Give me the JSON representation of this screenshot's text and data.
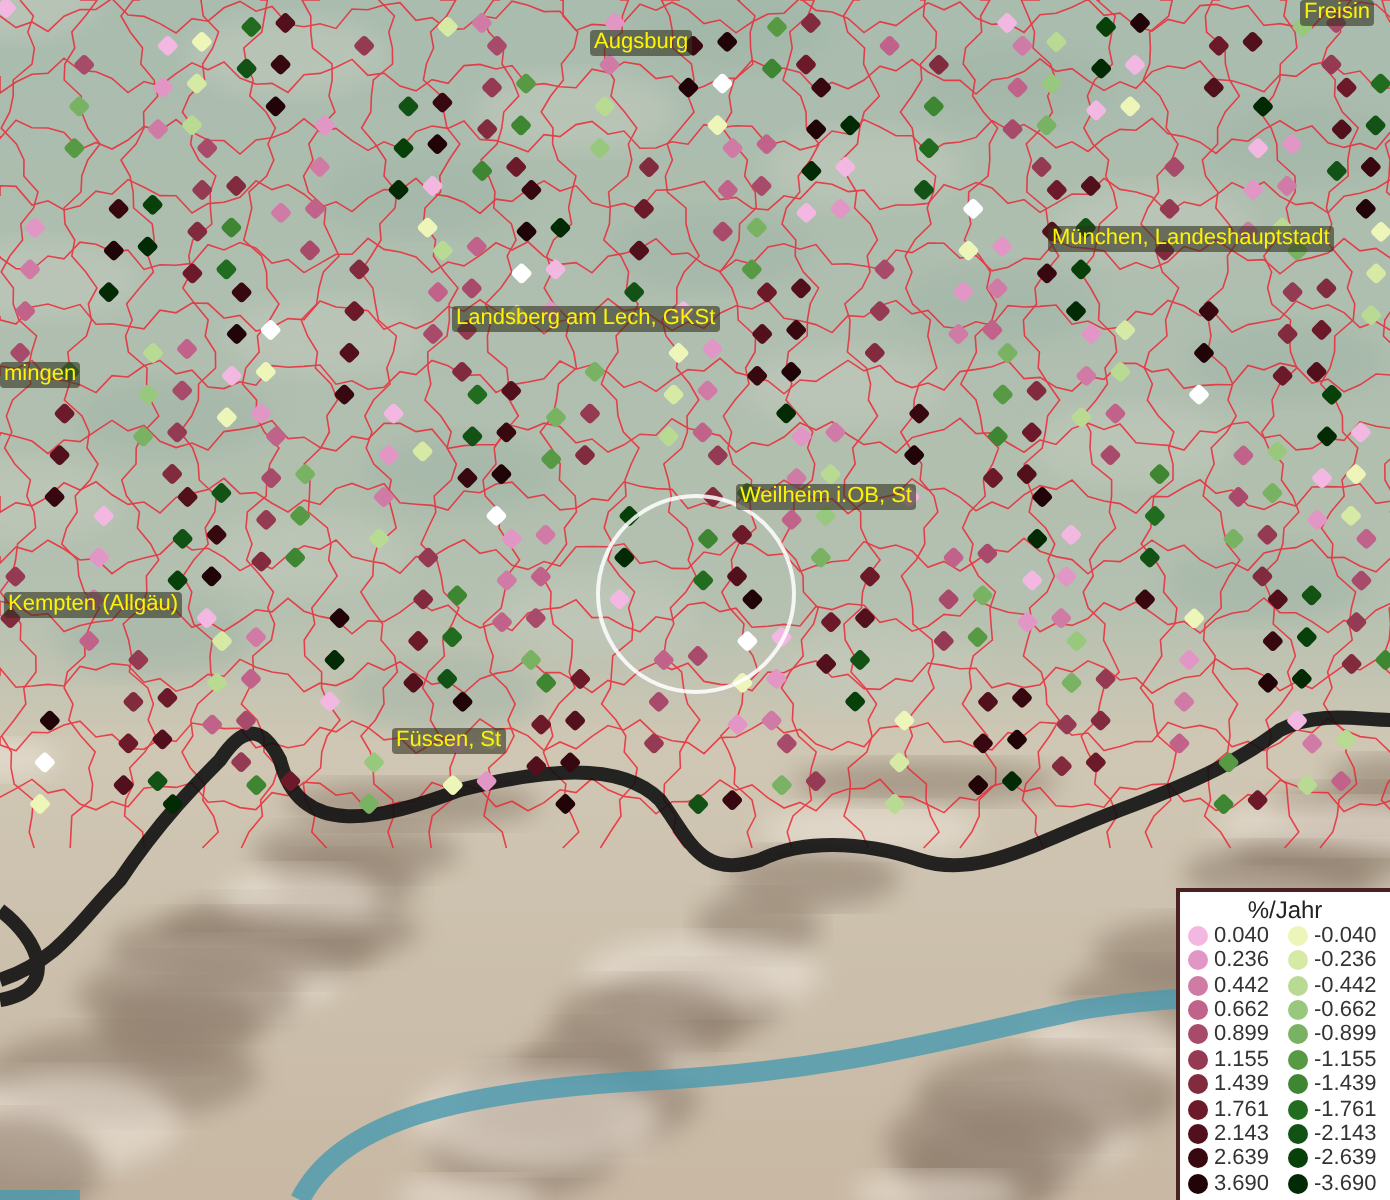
{
  "map": {
    "places": [
      {
        "name": "Augsburg"
      },
      {
        "name": "Freisin"
      },
      {
        "name": "München, Landeshauptstadt"
      },
      {
        "name": "Landsberg am Lech, GKSt"
      },
      {
        "name": "mingen"
      },
      {
        "name": "Weilheim i.OB, St"
      },
      {
        "name": "Kempten (Allgäu)"
      },
      {
        "name": "Füssen, St"
      }
    ]
  },
  "legend": {
    "title": "%/Jahr",
    "rows": [
      {
        "positive": {
          "label": "0.040",
          "color": "#f2b8e2"
        },
        "negative": {
          "label": "-0.040",
          "color": "#eef5b8"
        }
      },
      {
        "positive": {
          "label": "0.236",
          "color": "#e296c6"
        },
        "negative": {
          "label": "-0.236",
          "color": "#d6eaa6"
        }
      },
      {
        "positive": {
          "label": "0.442",
          "color": "#d07aa6"
        },
        "negative": {
          "label": "-0.442",
          "color": "#b8da92"
        }
      },
      {
        "positive": {
          "label": "0.662",
          "color": "#c0628a"
        },
        "negative": {
          "label": "-0.662",
          "color": "#98c87e"
        }
      },
      {
        "positive": {
          "label": "0.899",
          "color": "#a84a6a"
        },
        "negative": {
          "label": "-0.899",
          "color": "#78b262"
        }
      },
      {
        "positive": {
          "label": "1.155",
          "color": "#943a52"
        },
        "negative": {
          "label": "-1.155",
          "color": "#589a44"
        }
      },
      {
        "positive": {
          "label": "1.439",
          "color": "#822a3e"
        },
        "negative": {
          "label": "-1.439",
          "color": "#3e8632"
        }
      },
      {
        "positive": {
          "label": "1.761",
          "color": "#6c1a2a"
        },
        "negative": {
          "label": "-1.761",
          "color": "#226c20"
        }
      },
      {
        "positive": {
          "label": "2.143",
          "color": "#52101c"
        },
        "negative": {
          "label": "-2.143",
          "color": "#125214"
        }
      },
      {
        "positive": {
          "label": "2.639",
          "color": "#380810"
        },
        "negative": {
          "label": "-2.639",
          "color": "#08400a"
        }
      },
      {
        "positive": {
          "label": "3.690",
          "color": "#200408"
        },
        "negative": {
          "label": "-3.690",
          "color": "#022a04"
        }
      }
    ]
  }
}
